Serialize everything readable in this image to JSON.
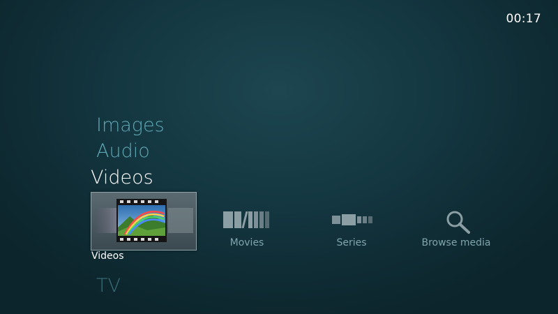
{
  "clock": "00:17",
  "categories": [
    "Images",
    "Audio",
    "Videos",
    "TV"
  ],
  "tiles": {
    "videos": "Videos",
    "movies": "Movies",
    "series": "Series",
    "browse": "Browse media"
  },
  "colors": {
    "accent": "#5fa7b4",
    "selected_text": "#ffffff",
    "tile_label": "#7fa5ad"
  },
  "icons": {
    "movies": "movies-icon",
    "series": "series-icon",
    "browse": "search-icon",
    "videos": "film-strip-icon"
  }
}
